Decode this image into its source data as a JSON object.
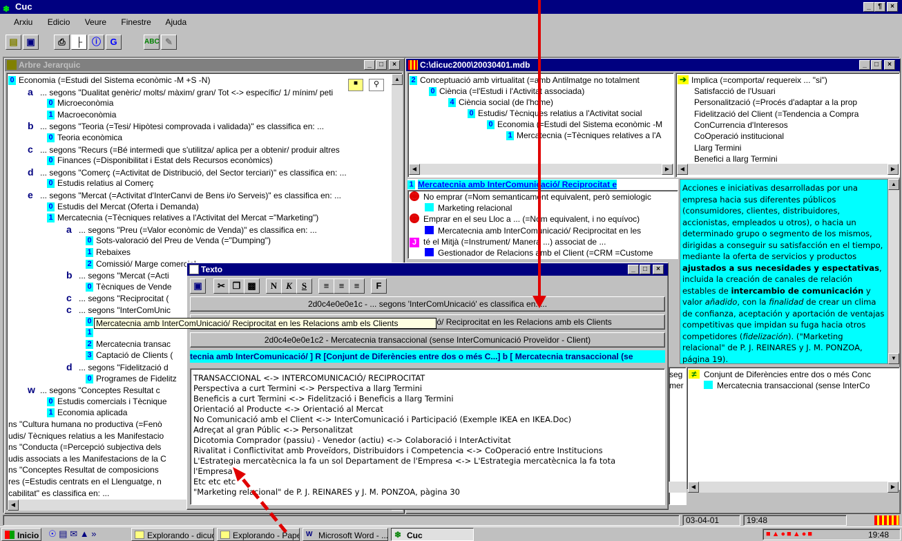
{
  "app": {
    "title": "Cuc",
    "title_buttons": [
      "_",
      "¶",
      "×"
    ]
  },
  "menu": [
    "Arxiu",
    "Edicio",
    "Veure",
    "Finestre",
    "Ajuda"
  ],
  "toolbar_icons": [
    "open-folder-icon",
    "save-icon",
    "print-icon",
    "tree-icon",
    "info-icon",
    "refresh-icon",
    "spellcheck-icon",
    "tool-icon"
  ],
  "tree_window": {
    "title": "Arbre Jerarquic",
    "rows": [
      {
        "type": "num",
        "badge": "0",
        "text": "Economia (=Estudi del Sistema econòmic -M +S -N)"
      },
      {
        "type": "let",
        "badge": "a",
        "text": "... segons \"Dualitat genèric/ molts/ màxim/ gran/ Tot <-> específic/ 1/ mínim/ peti"
      },
      {
        "type": "num",
        "badge": "0",
        "text": "Microeconòmia"
      },
      {
        "type": "num",
        "badge": "1",
        "text": "Macroeconòmia"
      },
      {
        "type": "let",
        "badge": "b",
        "text": "... segons \"Teoria (=Tesi/ Hipòtesi comprovada i validada)\" es classifica en: ..."
      },
      {
        "type": "num",
        "badge": "0",
        "text": "Teoria econòmica"
      },
      {
        "type": "let",
        "badge": "c",
        "text": "... segons \"Recurs (=Bé intermedi que s'utilitza/ aplica per a obtenir/ produir altres"
      },
      {
        "type": "num",
        "badge": "0",
        "text": "Finances (=Disponibilitat i Estat dels Recursos econòmics)"
      },
      {
        "type": "let",
        "badge": "d",
        "text": "... segons \"Comerç (=Activitat de Distribució, del Sector terciari)\" es classifica en: ..."
      },
      {
        "type": "num",
        "badge": "0",
        "text": "Estudis relatius al Comerç"
      },
      {
        "type": "let",
        "badge": "e",
        "text": "... segons \"Mercat (=Activitat d'InterCanvi de Bens i/o Serveis)\" es classifica en: ..."
      },
      {
        "type": "num",
        "badge": "0",
        "text": "Estudis del Mercat (Oferta i Demanda)"
      },
      {
        "type": "num",
        "badge": "1",
        "text": "Mercatecnia (=Tècniques relatives a l'Activitat del Mercat =\"Marketing\")"
      },
      {
        "type": "let",
        "badge": "a",
        "text": "... segons \"Preu (=Valor econòmic de Venda)\" es classifica en: ..."
      },
      {
        "type": "num",
        "badge": "0",
        "text": "Sots-valoració del Preu de Venda (=\"Dumping\")"
      },
      {
        "type": "num",
        "badge": "1",
        "text": "Rebaixes"
      },
      {
        "type": "num",
        "badge": "2",
        "text": "Comissió/ Marge comercial"
      },
      {
        "type": "let",
        "badge": "b",
        "text": "... segons \"Mercat (=Acti"
      },
      {
        "type": "num",
        "badge": "0",
        "text": "Tècniques de Vende"
      },
      {
        "type": "let",
        "badge": "c",
        "text": "... segons \"Reciprocitat ("
      },
      {
        "type": "let",
        "badge": "c",
        "text": "... segons \"InterComUnic"
      },
      {
        "type": "num",
        "badge": "0",
        "text": "Tracte exclussiu/ dir"
      },
      {
        "type": "num",
        "badge": "1",
        "text": ""
      },
      {
        "type": "num",
        "badge": "2",
        "text": "Mercatecnia transac"
      },
      {
        "type": "num",
        "badge": "3",
        "text": "Captació de Clients ("
      },
      {
        "type": "let",
        "badge": "d",
        "text": "... segons \"Fidelització d"
      },
      {
        "type": "num",
        "badge": "0",
        "text": "Programes de Fidelitz"
      },
      {
        "type": "let",
        "badge": "w",
        "text": "... segons \"Conceptes Resultat c"
      },
      {
        "type": "num",
        "badge": "0",
        "text": "Estudis comercials i Tècnique"
      },
      {
        "type": "num",
        "badge": "1",
        "text": "Economia aplicada"
      },
      {
        "type": "plain",
        "badge": "",
        "text": "ns \"Cultura humana no productiva (=Fenò"
      },
      {
        "type": "plain",
        "badge": "",
        "text": "udis/ Tècniques relatius a les Manifestacio"
      },
      {
        "type": "plain",
        "badge": "",
        "text": "ns \"Conducta (=Percepció subjectiva dels"
      },
      {
        "type": "plain",
        "badge": "",
        "text": "udis associats a les Manifestacions de la C"
      },
      {
        "type": "plain",
        "badge": "",
        "text": "ns \"Conceptes Resultat de composicions"
      },
      {
        "type": "plain",
        "badge": "",
        "text": "res (=Estudis centrats en el Llenguatge, n"
      },
      {
        "type": "plain",
        "badge": "",
        "text": "cabilitat\" es classifica en: ..."
      },
      {
        "type": "plain",
        "badge": "",
        "text": "at\" es classifica en: ..."
      }
    ],
    "tooltip": "Mercatecnia amb InterComUnicació/ Reciprocitat en les Relacions amb els Clients"
  },
  "db_window": {
    "title": "C:\\dicuc2000\\20030401.mdb",
    "tree": [
      {
        "badge": "2",
        "text": "Conceptuació amb virtualitat (=amb Antilmatge no totalment"
      },
      {
        "badge": "0",
        "text": "Ciència (=l'Estudi i l'Activitat associada)"
      },
      {
        "badge": "4",
        "text": "Ciència social (de l'home)"
      },
      {
        "badge": "0",
        "text": "Estudis/ Tècniques relatius a l'Activitat social"
      },
      {
        "badge": "0",
        "text": "Economia (=Estudi del Sistema econòmic -M"
      },
      {
        "badge": "1",
        "text": "Mercatecnia (=Tècniques relatives a l'A"
      }
    ],
    "implica_title": "Implica (=comporta/ requereix ... \"si\")",
    "implica": [
      "Satisfacció de l'Usuari",
      "Personalització (=Procés d'adaptar a la prop",
      "Fidelització del Client (=Tendencia a Compra",
      "ConCurrencia d'Interesos",
      "CoOperació institucional",
      "Llarg Termini",
      "Benefici a llarg Termini"
    ],
    "selected_badge": "1",
    "selected": "Mercatecnia amb InterComunicació/ Reciprocitat e",
    "relations": [
      {
        "kind": "rel",
        "text": "No emprar (=Nom semanticament equivalent, però semiologic"
      },
      {
        "kind": "cyan",
        "text": "Marketing relacional"
      },
      {
        "kind": "rel",
        "text": "Emprar en el seu Lloc a ... (=Nom equivalent, i no equívoc)"
      },
      {
        "kind": "blue",
        "text": "Mercatecnia amb InterComunicació/ Reciprocitat en les"
      },
      {
        "kind": "j",
        "text": "té el Mitjà (=Instrument/ Manera ...) associat de ..."
      },
      {
        "kind": "blue",
        "text": "Gestionador de Relacions amb el Client (=CRM =Custome"
      }
    ],
    "definition_parts": [
      {
        "t": "Acciones e iniciativas desarrolladas por una empresa hacia sus diferentes públicos (consumidores, clientes, distribuidores, accionistas, empleados u otros), o hacia un determinado grupo o segmento de los mismos, dirigidas a conseguir su satisfacción en el tiempo, mediante la oferta de servicios y productos ",
        "s": "n"
      },
      {
        "t": "ajustados a sus necesidades y espectativas",
        "s": "b"
      },
      {
        "t": ", incluida la creación de canales de relación estables de ",
        "s": "n"
      },
      {
        "t": "intercambio de comunicación",
        "s": "b"
      },
      {
        "t": " y valor ",
        "s": "n"
      },
      {
        "t": "añadido",
        "s": "i"
      },
      {
        "t": ", con la ",
        "s": "n"
      },
      {
        "t": "finalidad",
        "s": "i"
      },
      {
        "t": " de crear un clima de confianza, aceptación y aportación de ventajas competitivas que impidan su fuga hacia otros competidores (",
        "s": "n"
      },
      {
        "t": "fidelización",
        "s": "i"
      },
      {
        "t": "). (\"Marketing relacional\" de P. J. REINARES y J. M. PONZOA, página 19).",
        "s": "n"
      }
    ],
    "bottom_left": [
      "seg",
      "mer"
    ],
    "conjunt_title": "Conjunt de Diferències entre dos o més Conc",
    "conjunt_item": "Mercatecnia transaccional (sense InterCo"
  },
  "texto_window": {
    "title": "Texto",
    "format_buttons": [
      "N",
      "K",
      "S",
      "F"
    ],
    "btn1": "2d0c4e0e0e1c - ... segons 'InterComUnicació' es classifica en: ...",
    "btn2": "2d0c4e0e0e1c1 - Mercatecnia amb InterComUnicació/ Reciprocitat en les Relacions amb els Clients",
    "btn3": "2d0c4e0e0e1c2 - Mercatecnia transaccional (sense InterComunicació Proveïdor - Client)",
    "strip": "tecnia amb InterComunicació/ ]  R [Conjunt de Diferències entre dos o més C...]  b [ Mercatecnia transaccional (se",
    "lines": [
      "TRANSACCIONAL <-> INTERCOMUNICACIÓ/ RECIPROCITAT",
      "Perspectiva a curt Termini <-> Perspectiva a llarg Termini",
      "Beneficis a curt Termini <-> Fidelització i Beneficis a llarg Termini",
      "Orientació al Producte <-> Orientació al Mercat",
      "No Comunicació amb el Client <-> InterComunicació i Participació (Exemple IKEA en IKEA.Doc)",
      "Adreçat al gran Públic <-> Personalitzat",
      "Dicotomia Comprador (passiu) - Venedor (actiu) <-> Colaboració i InterActivitat",
      "Rivalitat i Conflictivitat amb Proveïdors, Distribuidors i Competencia <-> CoOperació entre Institucions",
      "L'Estrategia mercatècnica la fa un sol Departament de l'Empresa <-> L'Estrategia mercatècnica la fa tota",
      "l'Empresa",
      "Etc etc etc",
      "\"Marketing relacional\" de P. J. REINARES y J. M. PONZOA, pàgina 30"
    ]
  },
  "statusbar": {
    "date": "03-04-01",
    "time": "19:48"
  },
  "taskbar": {
    "start": "Inicio",
    "tasks": [
      "Explorando - dicuc...",
      "Explorando - Pape...",
      "Microsoft Word - ...",
      "Cuc"
    ],
    "clock": "19:48"
  },
  "colors": {
    "titlebar": "#000080",
    "cyan": "#00ffff",
    "badge_text": "#0000ff",
    "arrow": "#e00000"
  }
}
